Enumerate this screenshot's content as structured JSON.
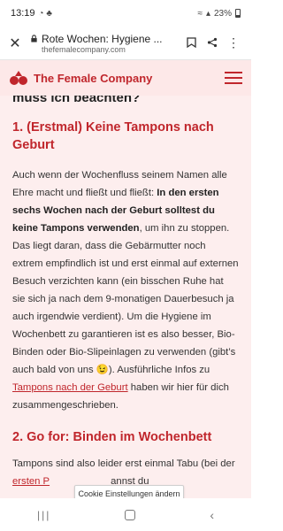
{
  "status_bar": {
    "time": "13:19",
    "battery": "23%"
  },
  "browser": {
    "page_title": "Rote Wochen: Hygiene ...",
    "domain": "thefemalecompany.com"
  },
  "site": {
    "brand": "The Female Company",
    "accent_color": "#c0262c",
    "header_bg": "#fde8e8"
  },
  "article": {
    "partial_heading": "muss ich beachten?",
    "section1_heading": "1. (Erstmal) Keine Tampons nach Geburt",
    "para1_part1": "Auch wenn der Wochenfluss seinem Namen alle Ehre macht und fließt und fließt: ",
    "para1_bold": "In den ersten sechs Wochen nach der Geburt solltest du keine Tampons verwenden",
    "para1_part2": ", um ihn zu stoppen. Das liegt daran, dass die Gebärmutter noch extrem empfindlich ist und erst einmal auf externen Besuch verzichten kann (ein bisschen Ruhe hat sie sich ja nach dem 9-monatigen Dauerbesuch ja auch irgendwie verdient). Um die Hygiene im Wochenbett zu garantieren ist es also besser, Bio-Binden oder Bio-Slipeinlagen zu verwenden (gibt’s auch bald von uns ",
    "para1_emoji": "😉",
    "para1_part3": "). Ausführliche Infos zu ",
    "para1_link": "Tampons nach der Geburt",
    "para1_part4": " haben wir hier für dich zusammengeschrieben.",
    "section2_heading": "2. Go for: Binden im Wochenbett",
    "para2_part1": "Tampons sind also leider erst einmal Tabu (bei der ",
    "para2_link": "ersten P",
    "para2_part2": "annst du"
  },
  "cookie": {
    "label": "Cookie Einstellungen ändern"
  },
  "icons": {
    "close": "close-icon",
    "lock": "lock-icon",
    "bookmark": "bookmark-icon",
    "share": "share-icon",
    "more": "more-vert-icon",
    "menu": "hamburger-menu-icon"
  }
}
